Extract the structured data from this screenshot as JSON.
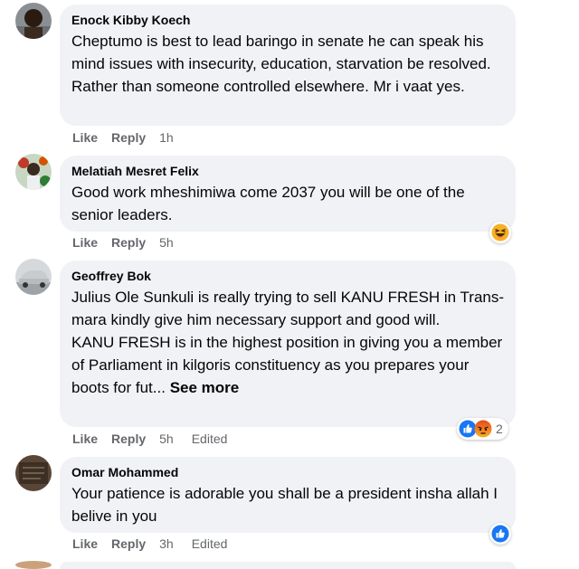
{
  "comments": [
    {
      "author": "Enock Kibby Koech",
      "text": "Cheptumo is best to lead baringo in senate he can speak his mind issues with insecurity, education, starvation be resolved. Rather than someone controlled elsewhere. Mr i vaat yes.",
      "like": "Like",
      "reply": "Reply",
      "time": "1h"
    },
    {
      "author": "Melatiah Mesret Felix",
      "text": "Good work mheshimiwa come 2037 you will be one of the senior leaders.",
      "like": "Like",
      "reply": "Reply",
      "time": "5h",
      "reactions": [
        "laughing-squint-emoji"
      ]
    },
    {
      "author": "Geoffrey Bok",
      "text": "Julius Ole Sunkuli is really trying to sell KANU FRESH in Trans-mara kindly give him necessary support and good will.",
      "text2": "KANU FRESH is in the highest position in giving you a member of Parliament in kilgoris constituency as you prepares your boots for fut...",
      "see_more": "See more",
      "like": "Like",
      "reply": "Reply",
      "time": "5h",
      "edited": "Edited",
      "reactions": [
        "thumbs-up-reaction",
        "angry-reaction"
      ],
      "reaction_count": "2"
    },
    {
      "author": "Omar Mohammed",
      "text": "Your patience is adorable you shall be a president insha allah I belive in you",
      "like": "Like",
      "reply": "Reply",
      "time": "3h",
      "edited": "Edited",
      "reactions": [
        "thumbs-up-reaction"
      ]
    }
  ],
  "colors": {
    "bubble": "#f0f2f5",
    "meta": "#65676b",
    "like_blue": "#1877f2",
    "angry_orange": "#e9710f"
  }
}
